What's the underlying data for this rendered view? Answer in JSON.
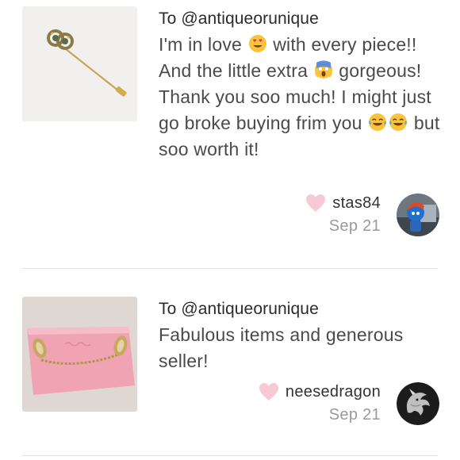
{
  "reviews": [
    {
      "recipient": "To @antiqueorunique",
      "message_parts": {
        "p1": "I'm in love ",
        "p2": " with every piece!! And the little extra ",
        "p3": " gorgeous! Thank you soo much! I might just go broke buying frim you ",
        "p4": " but soo worth it!"
      },
      "emojis": [
        "heart-eyes-emoji",
        "screaming-emoji",
        "tears-of-joy-emoji",
        "tears-of-joy-emoji"
      ],
      "username": "stas84",
      "date": "Sep 21",
      "product": "gold-stick-pin"
    },
    {
      "recipient": "To @antiqueorunique",
      "message": "Fabulous items and generous seller!",
      "username": "neesedragon",
      "date": "Sep 21",
      "product": "pink-box-chain-brooch"
    }
  ],
  "colors": {
    "heart": "#f7c9d2",
    "text_primary": "#2b2b2b",
    "text_secondary": "#4a4a4a",
    "date": "#9a9a9a",
    "divider": "#e3e3e3"
  }
}
